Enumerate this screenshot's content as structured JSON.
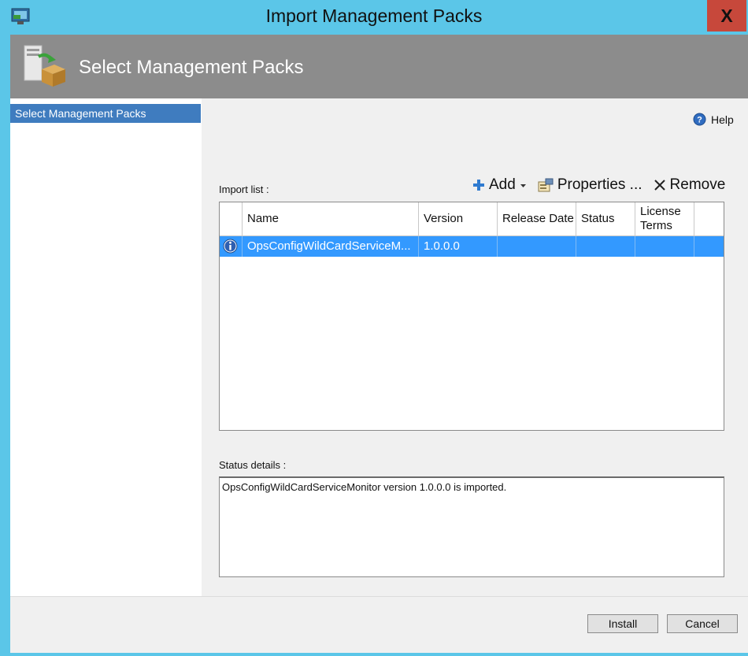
{
  "window": {
    "title": "Import Management Packs",
    "close_label": "X"
  },
  "header": {
    "title": "Select Management Packs"
  },
  "nav": {
    "items": [
      {
        "label": "Select Management Packs"
      }
    ]
  },
  "help": {
    "label": "Help"
  },
  "import_list": {
    "label": "Import list :",
    "toolbar": {
      "add": "Add",
      "properties": "Properties ...",
      "remove": "Remove"
    },
    "columns": [
      "Name",
      "Version",
      "Release Date",
      "Status",
      "License Terms"
    ],
    "rows": [
      {
        "icon": "info-icon",
        "name": "OpsConfigWildCardServiceM...",
        "version": "1.0.0.0",
        "release_date": "",
        "status": "",
        "license_terms": ""
      }
    ]
  },
  "status_details": {
    "label": "Status details :",
    "text": "OpsConfigWildCardServiceMonitor version 1.0.0.0 is imported."
  },
  "buttons": {
    "install": "Install",
    "cancel": "Cancel"
  },
  "colors": {
    "titlebar": "#5bc6e8",
    "header_band": "#8c8c8c",
    "selection": "#3399ff",
    "nav_selected": "#3f7cbf",
    "close": "#c7483b"
  }
}
